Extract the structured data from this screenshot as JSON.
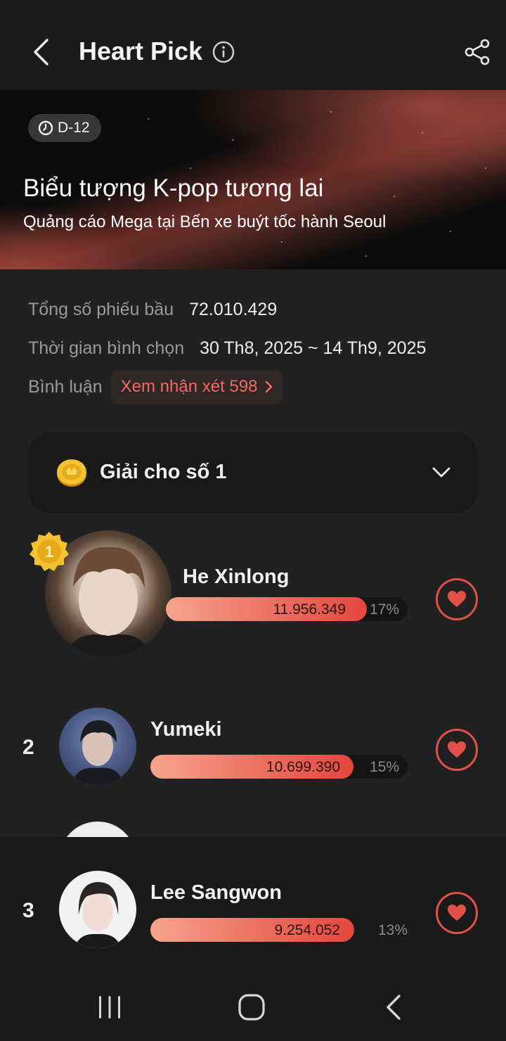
{
  "header": {
    "title": "Heart Pick",
    "back_icon": "chevron-left-icon",
    "info_icon": "info-circle-icon",
    "share_icon": "share-icon"
  },
  "banner": {
    "dday": "D-12",
    "title": "Biểu tượng K-pop tương lai",
    "subtitle": "Quảng cáo Mega tại Bến xe buýt tốc hành Seoul"
  },
  "info": {
    "total_votes_label": "Tổng số phiếu bầu",
    "total_votes_value": "72.010.429",
    "period_label": "Thời gian bình chọn",
    "period_value": "30 Th8, 2025 ~ 14 Th9, 2025",
    "comments_label": "Bình luận",
    "comments_button": "Xem nhận xét 598"
  },
  "award": {
    "label": "Giải cho số 1",
    "icon": "gold-coin-icon"
  },
  "rankings": [
    {
      "rank": "1",
      "name": "He Xinlong",
      "votes": "11.956.349",
      "percent": "17%",
      "fill": 0.83
    },
    {
      "rank": "2",
      "name": "Yumeki",
      "votes": "10.699.390",
      "percent": "15%",
      "fill": 0.79
    },
    {
      "rank": "3",
      "name": "Lee Sangwon",
      "votes": "9.254.052",
      "percent": "13%",
      "fill": 0.79
    }
  ],
  "colors": {
    "accent": "#e2504a",
    "background": "#212121",
    "bar_start": "#f5a48d",
    "bar_end": "#e4463e"
  }
}
